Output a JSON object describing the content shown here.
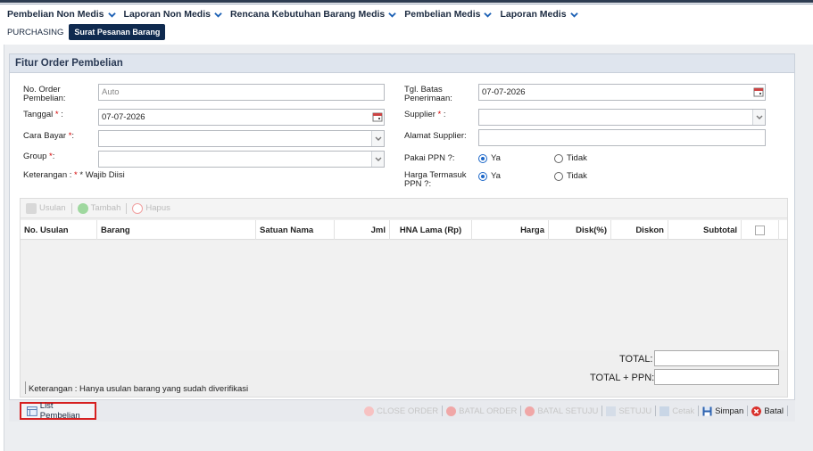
{
  "nav": {
    "items": [
      {
        "label": "Pembelian Non Medis"
      },
      {
        "label": "Laporan Non Medis"
      },
      {
        "label": "Rencana Kebutuhan Barang Medis"
      },
      {
        "label": "Pembelian Medis"
      },
      {
        "label": "Laporan Medis"
      }
    ]
  },
  "breadcrumb": {
    "root": "PURCHASING",
    "active": "Surat Pesanan Barang"
  },
  "panel": {
    "title": "Fitur Order Pembelian"
  },
  "form": {
    "no_order_label_1": "No. Order",
    "no_order_label_2": "Pembelian:",
    "no_order_value": "Auto",
    "tanggal_label": "Tanggal",
    "tanggal_value": "07-07-2026",
    "cara_bayar_label": "Cara Bayar",
    "cara_bayar_value": "",
    "group_label": "Group",
    "group_value": "",
    "keterangan_label": "Keterangan :",
    "wajib_label": "* Wajib Diisi",
    "tgl_batas_label_1": "Tgl. Batas",
    "tgl_batas_label_2": "Penerimaan:",
    "tgl_batas_value": "07-07-2026",
    "supplier_label": "Supplier",
    "supplier_value": "",
    "alamat_label": "Alamat Supplier:",
    "alamat_value": "",
    "ppn_label": "Pakai PPN ?:",
    "ppn_yes": "Ya",
    "ppn_no": "Tidak",
    "harga_ppn_label_1": "Harga Termasuk",
    "harga_ppn_label_2": "PPN ?:",
    "harga_ppn_yes": "Ya",
    "harga_ppn_no": "Tidak",
    "required_mark": "*",
    "colon": ":"
  },
  "grid_toolbar": {
    "usulan": "Usulan",
    "tambah": "Tambah",
    "hapus": "Hapus"
  },
  "columns": [
    "No. Usulan",
    "Barang",
    "Satuan Nama",
    "Jml",
    "HNA Lama (Rp)",
    "Harga",
    "Disk(%)",
    "Diskon",
    "Subtotal"
  ],
  "totals": {
    "total_label": "TOTAL:",
    "total_ppn_label": "TOTAL + PPN:",
    "total_value": "",
    "total_ppn_value": ""
  },
  "note": "Keterangan : Hanya usulan barang yang sudah diverifikasi",
  "footer": {
    "list_button": "List Pembelian",
    "close_order": "CLOSE ORDER",
    "batal_order": "BATAL ORDER",
    "batal_setuju": "BATAL SETUJU",
    "setuju": "SETUJU",
    "cetak": "Cetak",
    "simpan": "Simpan",
    "batal": "Batal"
  },
  "colors": {
    "navy": "#0f2a4f",
    "panel_head": "#dfe5ee",
    "highlight_border": "#d62020",
    "radio_accent": "#1a66c8",
    "cancel_red": "#d9302b"
  }
}
